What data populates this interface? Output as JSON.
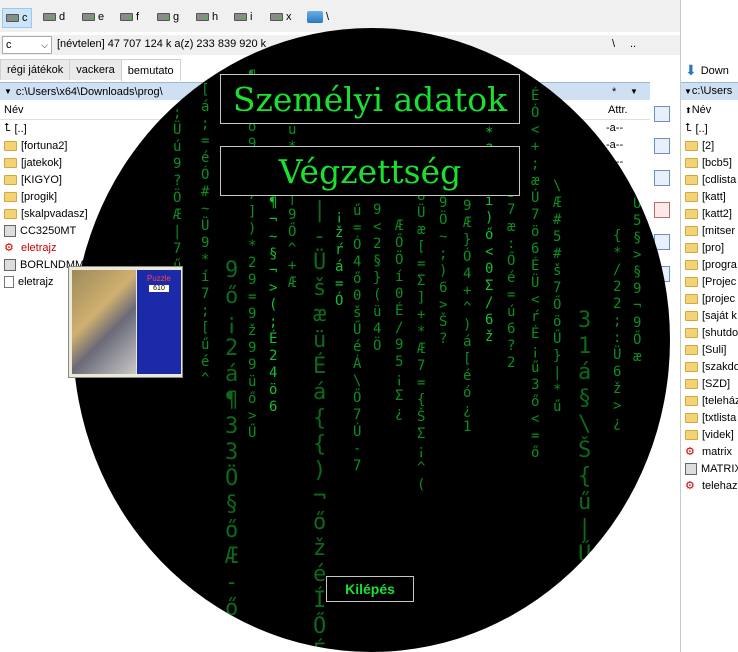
{
  "drives": [
    "c",
    "d",
    "e",
    "f",
    "g",
    "h",
    "i",
    "x",
    "\\"
  ],
  "right_drive_label": "c",
  "path_row": {
    "drive": "c",
    "volume_info": "[névtelen]  47 707 124 k a(z) 233 839 920 k",
    "root_btn": "\\",
    "up_btn": ".."
  },
  "tabs": [
    "régi játékok",
    "vackera",
    "bemutato"
  ],
  "left_path": "c:\\Users\\x64\\Downloads\\prog\\",
  "columns": {
    "name": "Név",
    "attr": "Attr.",
    "star": "*"
  },
  "left_files": [
    {
      "name": "[..]",
      "type": "up"
    },
    {
      "name": "[fortuna2]",
      "type": "folder"
    },
    {
      "name": "[jatekok]",
      "type": "folder"
    },
    {
      "name": "[KIGYO]",
      "type": "folder"
    },
    {
      "name": "[progik]",
      "type": "folder"
    },
    {
      "name": "[skalpvadasz]",
      "type": "folder"
    },
    {
      "name": "CC3250MT",
      "type": "exe"
    },
    {
      "name": "eletrajz",
      "type": "red"
    },
    {
      "name": "BORLNDMM",
      "type": "file"
    },
    {
      "name": "eletrajz",
      "type": "file"
    }
  ],
  "attr_values": [
    "-a--",
    "-a--",
    "-a--"
  ],
  "right_panel": {
    "drive": "c",
    "download_label": "Down",
    "path": "c:\\Users",
    "col_name": "Név",
    "items": [
      "[..]",
      "[2]",
      "[bcb5]",
      "[cdlista",
      "[katt]",
      "[katt2]",
      "[mitser",
      "[pro]",
      "[progra",
      "[Projec",
      "[projec",
      "[saját k",
      "[shutdo",
      "[Suli]",
      "[szakdo",
      "[SZD]",
      "[teleház",
      "[txtlista",
      "[videk]",
      "matrix",
      "MATRIX",
      "telehaz"
    ]
  },
  "app": {
    "btn1": "Személyi adatok",
    "btn2": "Végzettség",
    "exit": "Kilépés"
  },
  "thumb": {
    "title": "Puzzle",
    "score": "610"
  },
  "colors": {
    "matrix_green": "#19e22e",
    "bg": "#000000"
  }
}
